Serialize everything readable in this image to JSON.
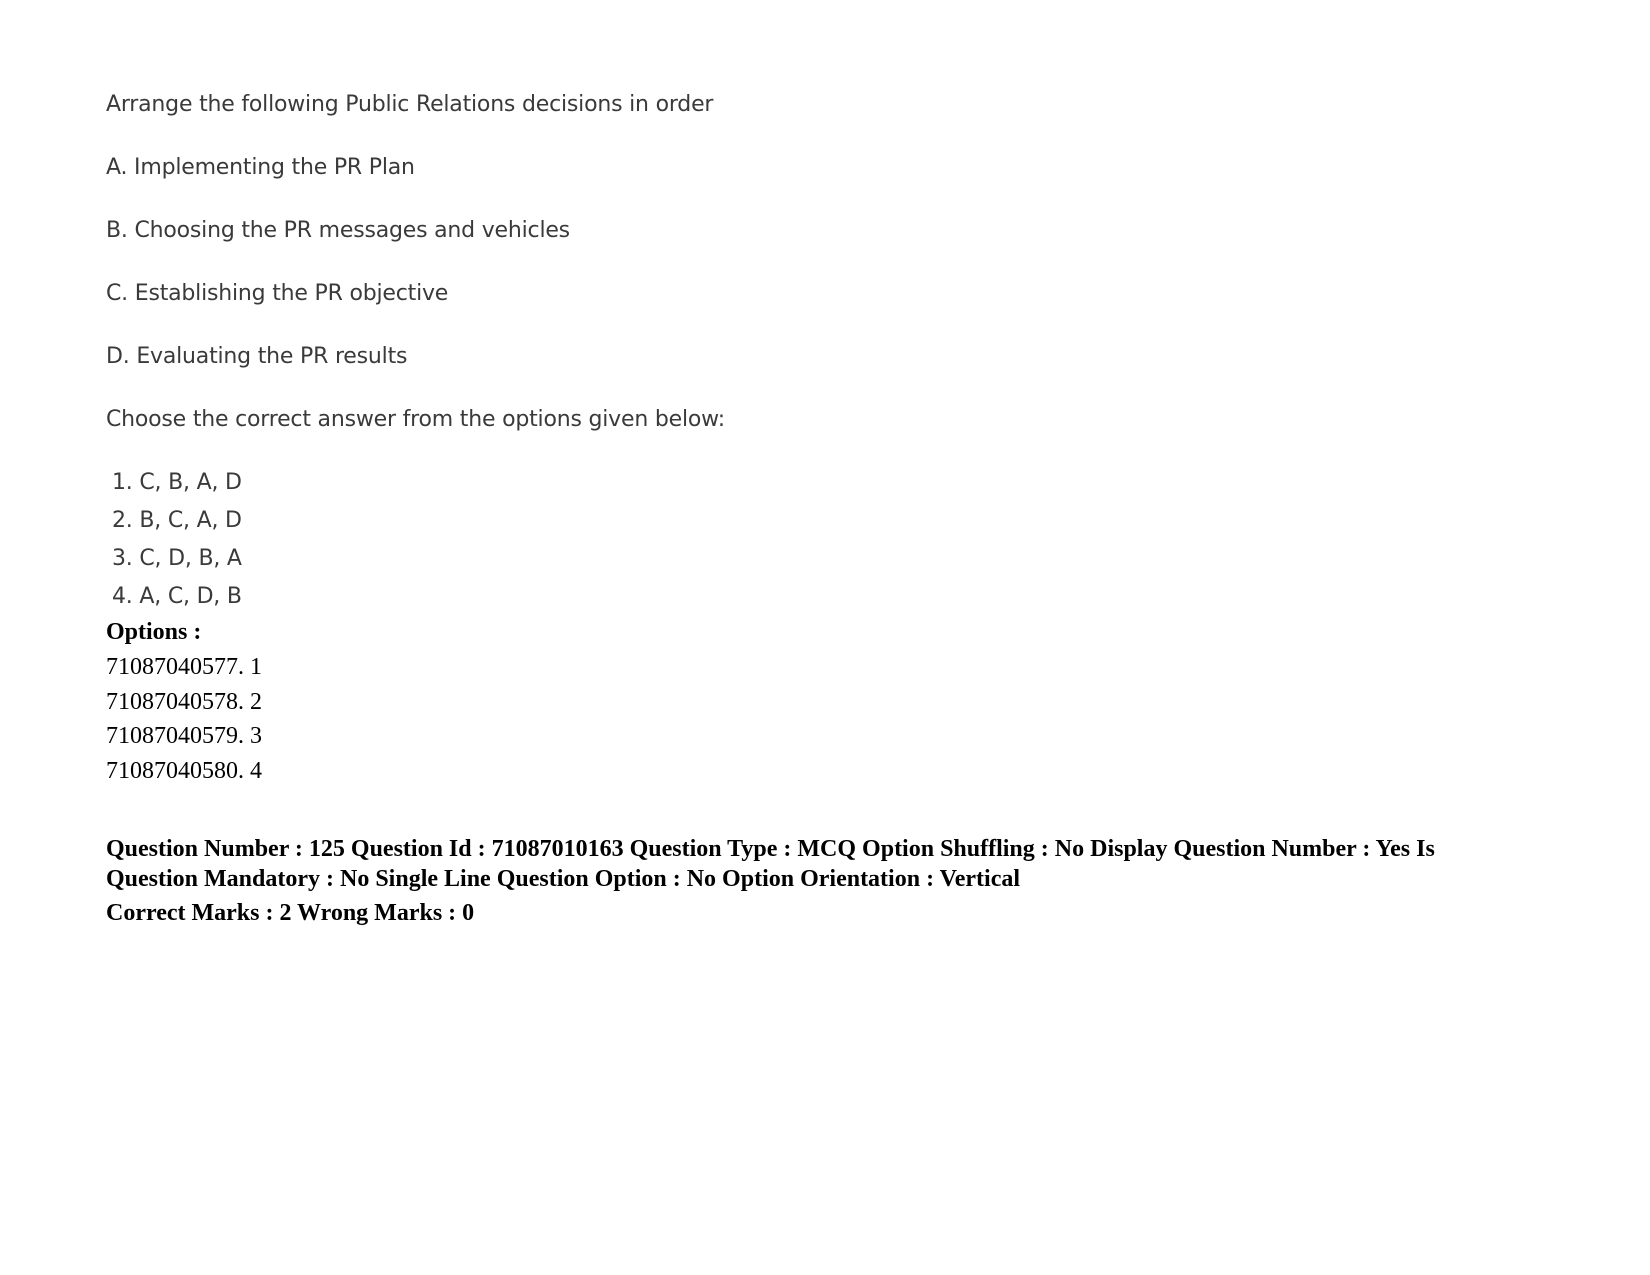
{
  "question": {
    "stem": "Arrange the following Public Relations decisions in order",
    "items": [
      "A. Implementing the PR Plan",
      "B. Choosing the PR messages and vehicles",
      "C. Establishing the PR objective",
      "D. Evaluating the PR results"
    ],
    "instruction": "Choose the correct answer from the options given below:",
    "choices": [
      "1. C, B, A, D",
      "2. B, C, A, D",
      "3. C, D, B, A",
      "4. A, C, D, B"
    ]
  },
  "options": {
    "label": "Options :",
    "list": [
      "71087040577. 1",
      "71087040578. 2",
      "71087040579. 3",
      "71087040580. 4"
    ]
  },
  "meta": {
    "line1": "Question Number : 125 Question Id : 71087010163 Question Type : MCQ Option Shuffling : No Display Question Number : Yes Is Question Mandatory : No Single Line Question Option : No Option Orientation : Vertical",
    "line2": "Correct Marks : 2 Wrong Marks : 0"
  }
}
